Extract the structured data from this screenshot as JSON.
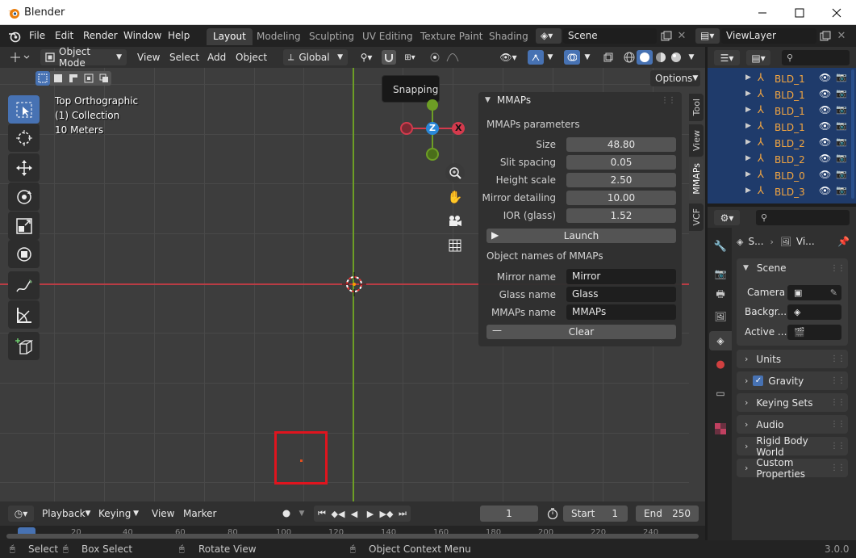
{
  "window": {
    "title": "Blender"
  },
  "menu": [
    "File",
    "Edit",
    "Render",
    "Window",
    "Help"
  ],
  "workspaces": [
    "Layout",
    "Modeling",
    "Sculpting",
    "UV Editing",
    "Texture Paint",
    "Shading"
  ],
  "scene_field": "Scene",
  "viewlayer_field": "ViewLayer",
  "viewport_header": {
    "mode": "Object Mode",
    "menus": [
      "View",
      "Select",
      "Add",
      "Object"
    ],
    "orientation": "Global",
    "options_label": "Options"
  },
  "tooltip": "Snapping",
  "overlay": {
    "line1": "Top Orthographic",
    "line2": "(1) Collection",
    "line3": "10 Meters"
  },
  "gizmo": {
    "z": "Z",
    "x": "X"
  },
  "npanel": {
    "header": "MMAPs",
    "section1": "MMAPs parameters",
    "params": [
      {
        "label": "Size",
        "value": "48.80"
      },
      {
        "label": "Slit spacing",
        "value": "0.05"
      },
      {
        "label": "Height scale",
        "value": "2.50"
      },
      {
        "label": "Mirror detailing",
        "value": "10.00"
      },
      {
        "label": "IOR (glass)",
        "value": "1.52"
      }
    ],
    "launch": "Launch",
    "section2": "Object names of MMAPs",
    "names": [
      {
        "label": "Mirror name",
        "value": "Mirror"
      },
      {
        "label": "Glass name",
        "value": "Glass"
      },
      {
        "label": "MMAPs name",
        "value": "MMAPs"
      }
    ],
    "clear": "Clear"
  },
  "vertical_tabs": [
    "Tool",
    "View",
    "MMAPs",
    "VCF"
  ],
  "timeline": {
    "playback": "Playback",
    "keying": "Keying",
    "view": "View",
    "marker": "Marker",
    "current_frame": "1",
    "start_label": "Start",
    "start": "1",
    "end_label": "End",
    "end": "250",
    "ruler": [
      "20",
      "40",
      "60",
      "80",
      "100",
      "120",
      "140",
      "160",
      "180",
      "200",
      "220",
      "240"
    ]
  },
  "outliner_rows": [
    "BLD_1",
    "BLD_1",
    "BLD_1",
    "BLD_1",
    "BLD_2",
    "BLD_2",
    "BLD_0",
    "BLD_3"
  ],
  "properties": {
    "breadcrumb_scene": "S...",
    "breadcrumb_view": "Vi...",
    "scene_panel": "Scene",
    "camera_label": "Camera",
    "background_label": "Backgr...",
    "active_label": "Active ...",
    "panels": [
      "Units",
      "Gravity",
      "Keying Sets",
      "Audio",
      "Rigid Body World",
      "Custom Properties"
    ]
  },
  "statusbar": {
    "select": "Select",
    "box_select": "Box Select",
    "rotate_view": "Rotate View",
    "context_menu": "Object Context Menu",
    "version": "3.0.0"
  },
  "colors": {
    "accent": "#4772b3",
    "x_axis": "#b83c44",
    "y_axis": "#6d9e25",
    "gizmo_z": "#2a88d8",
    "gizmo_x": "#d43a4d",
    "highlight_box": "#e0141e",
    "outliner_bg": "#1f3b6b"
  }
}
